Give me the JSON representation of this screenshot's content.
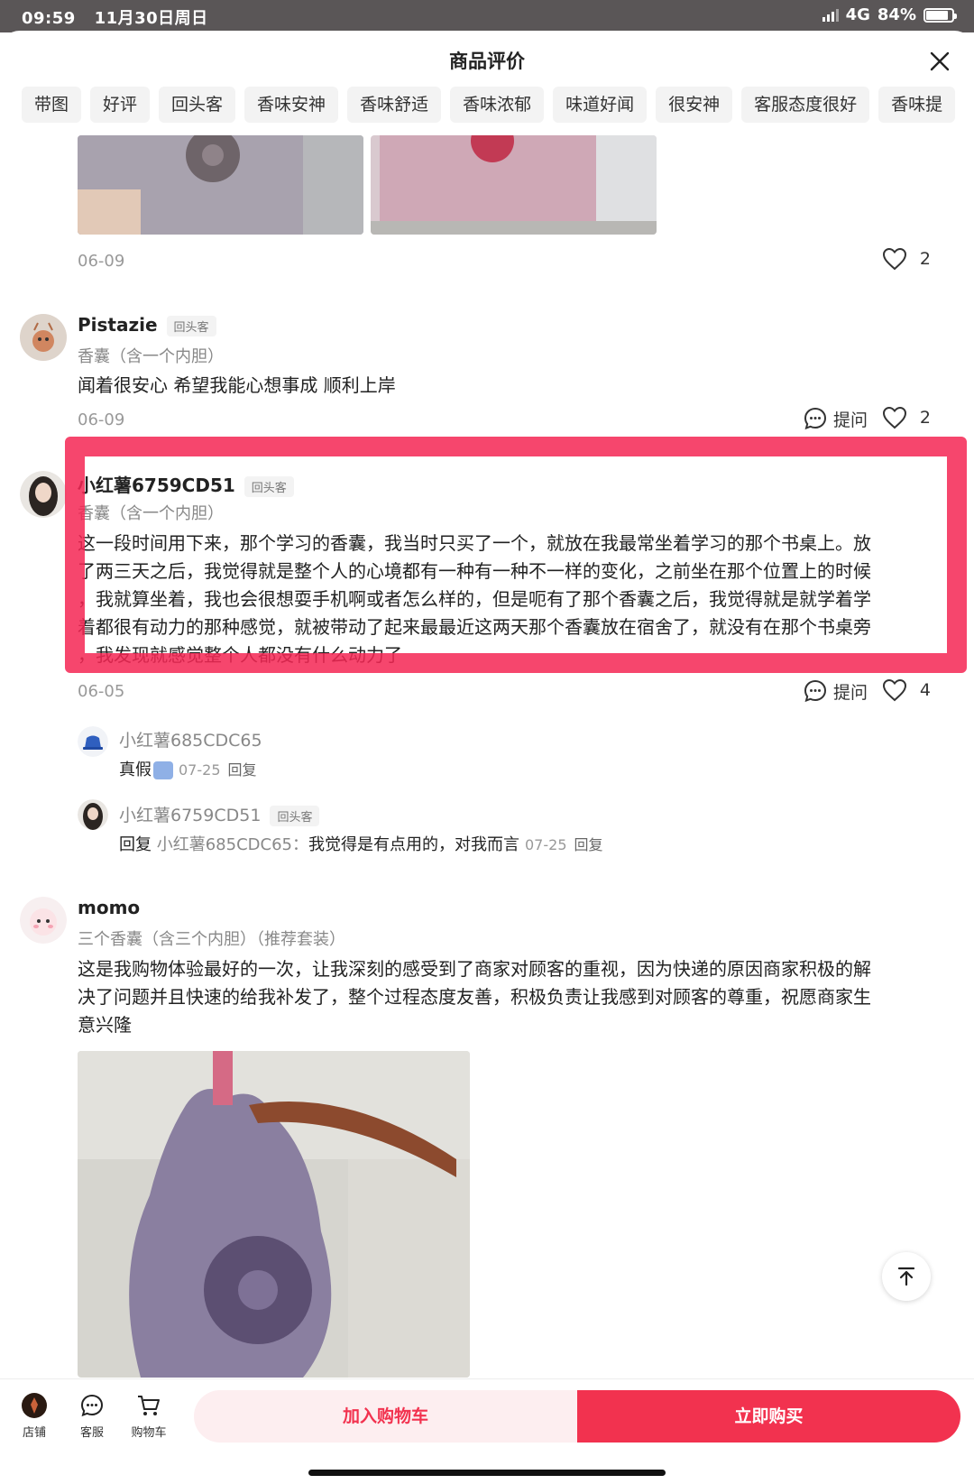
{
  "status_bar": {
    "time": "09:59",
    "date": "11月30日周日",
    "network": "4G",
    "battery": "84%"
  },
  "header": {
    "title": "商品评价"
  },
  "tags": [
    "带图",
    "好评",
    "回头客",
    "香味安神",
    "香味舒适",
    "香味浓郁",
    "味道好闻",
    "很安神",
    "客服态度很好",
    "香味提"
  ],
  "reviews": [
    {
      "date": "06-09",
      "likes": "2"
    },
    {
      "user": "Pistazie",
      "badge": "回头客",
      "variant": "香囊（含一个内胆）",
      "text": "闻着很安心 希望我能心想事成 顺利上岸",
      "date": "06-09",
      "ask": "提问",
      "likes": "2"
    },
    {
      "user": "小红薯6759CD51",
      "badge": "回头客",
      "variant": "香囊（含一个内胆）",
      "text_lines": [
        "这一段时间用下来，那个学习的香囊，我当时只买了一个，就放在我最常坐着学习的那个书桌上。放",
        "了两三天之后，我觉得就是整个人的心境都有一种有一种不一样的变化，之前坐在那个位置上的时候",
        "，我就算坐着，我也会很想耍手机啊或者怎么样的，但是呃有了那个香囊之后，我觉得就是就学着学",
        "着都很有动力的那种感觉，就被带动了起来最最近这两天那个香囊放在宿舍了，就没有在那个书桌旁",
        "，我发现就感觉整个人都没有什么动力了"
      ],
      "date": "06-05",
      "ask": "提问",
      "likes": "4",
      "replies": [
        {
          "user": "小红薯685CDC65",
          "text": "真假",
          "date": "07-25",
          "reply_label": "回复"
        },
        {
          "user": "小红薯6759CD51",
          "badge": "回头客",
          "prefix": "回复",
          "ref_user": "小红薯685CDC65：",
          "text": "我觉得是有点用的，对我而言",
          "date": "07-25",
          "reply_label": "回复"
        }
      ]
    },
    {
      "user": "momo",
      "variant": "三个香囊（含三个内胆）（推荐套装）",
      "text_lines": [
        "这是我购物体验最好的一次，让我深刻的感受到了商家对顾客的重视，因为快递的原因商家积极的解",
        "决了问题并且快速的给我补发了，整个过程态度友善，积极负责让我感到对顾客的尊重，祝愿商家生",
        "意兴隆"
      ]
    }
  ],
  "bottom_bar": {
    "store": "店铺",
    "service": "客服",
    "cart": "购物车",
    "add_to_cart": "加入购物车",
    "buy_now": "立即购买"
  },
  "colors": {
    "accent": "#f2324f",
    "highlight": "#f42654"
  }
}
